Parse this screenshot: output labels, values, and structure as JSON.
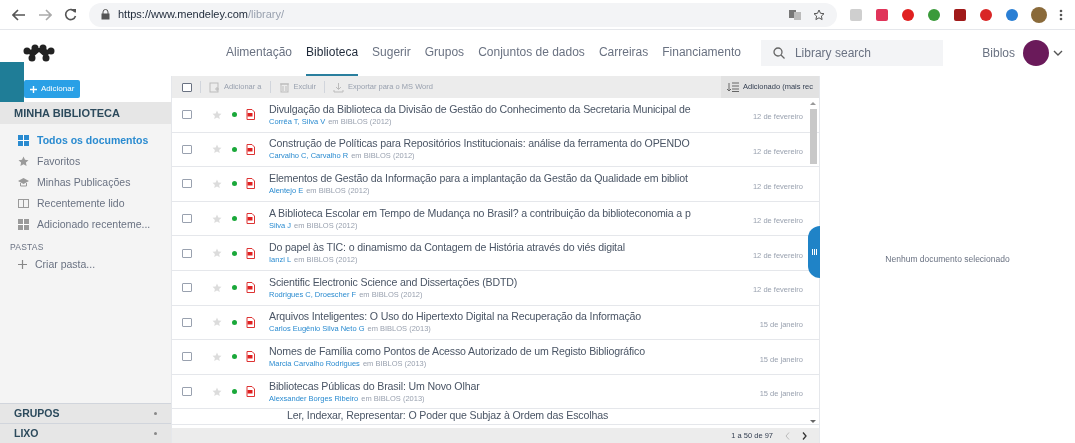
{
  "browser": {
    "url_host": "https://www.mendeley.com",
    "url_path": "/library/"
  },
  "nav": [
    {
      "label": "Alimentação",
      "selected": false
    },
    {
      "label": "Biblioteca",
      "selected": true
    },
    {
      "label": "Sugerir",
      "selected": false
    },
    {
      "label": "Grupos",
      "selected": false
    },
    {
      "label": "Conjuntos de dados",
      "selected": false
    },
    {
      "label": "Carreiras",
      "selected": false
    },
    {
      "label": "Financiamento",
      "selected": false
    }
  ],
  "search": {
    "placeholder": "Library search"
  },
  "user": {
    "name": "Biblos"
  },
  "sidebar": {
    "add_button": "Adicionar",
    "title": "MINHA BIBLIOTECA",
    "items": [
      {
        "label": "Todos os documentos",
        "kind": "grid",
        "selected": true
      },
      {
        "label": "Favoritos",
        "kind": "star",
        "selected": false
      },
      {
        "label": "Minhas Publicações",
        "kind": "cap",
        "selected": false
      },
      {
        "label": "Recentemente lido",
        "kind": "book",
        "selected": false
      },
      {
        "label": "Adicionado recenteme...",
        "kind": "grid",
        "selected": false
      }
    ],
    "folders_title": "PASTAS",
    "create_folder": "Criar pasta...",
    "bottom": [
      "GRUPOS",
      "LIXO"
    ]
  },
  "toolbar": {
    "select_all_checked": false,
    "add_to": "Adicionar a",
    "delete": "Excluir",
    "export": "Exportar para o MS Word",
    "sort": "Adicionado (mais rec"
  },
  "rows": [
    {
      "kind": "document",
      "title": "Divulgação da Biblioteca da Divisão de Gestão do Conhecimento da Secretaria Municipal de",
      "authors": "Corrêa T, Silva V",
      "source": "em BIBLOS (2012)",
      "date": "12 de fevereiro",
      "checked": false,
      "starred": false,
      "unread": true
    },
    {
      "kind": "document",
      "title": "Construção de Políticas para Repositórios Institucionais: análise da ferramenta do OPENDO",
      "authors": "Carvalho C, Carvalho R",
      "source": "em BIBLOS (2012)",
      "date": "12 de fevereiro",
      "checked": false,
      "starred": false,
      "unread": true
    },
    {
      "kind": "document",
      "title": "Elementos de Gestão da Informação para a implantação da Gestão da Qualidade em bibliot",
      "authors": "Alentejo E",
      "source": "em BIBLOS (2012)",
      "date": "12 de fevereiro",
      "checked": false,
      "starred": false,
      "unread": true
    },
    {
      "kind": "document",
      "title": "A Biblioteca Escolar em Tempo de Mudança no Brasil? a contribuição da biblioteconomia a p",
      "authors": "Silva J",
      "source": "em BIBLOS (2012)",
      "date": "12 de fevereiro",
      "checked": false,
      "starred": false,
      "unread": true
    },
    {
      "kind": "document",
      "title": "Do papel às TIC: o dinamismo da Contagem de História através do viés digital",
      "authors": "Ianzi L",
      "source": "em BIBLOS (2012)",
      "date": "12 de fevereiro",
      "checked": false,
      "starred": false,
      "unread": true
    },
    {
      "kind": "document",
      "title": "Scientific Electronic Science and Dissertações (BDTD)",
      "authors": "Rodrigues C, Droescher F",
      "source": "em BIBLOS (2012)",
      "date": "12 de fevereiro",
      "checked": false,
      "starred": false,
      "unread": true
    },
    {
      "kind": "document",
      "title": "Arquivos Inteligentes: O Uso do Hipertexto Digital na Recuperação da Informação",
      "authors": "Carlos Eugênio Silva Neto G",
      "source": "em BIBLOS (2013)",
      "date": "15 de janeiro",
      "checked": false,
      "starred": false,
      "unread": true
    },
    {
      "kind": "document",
      "title": "Nomes de Família como Pontos de Acesso Autorizado de um Registo Bibliográfico",
      "authors": "Marcia Carvalho Rodrigues",
      "source": "em BIBLOS (2013)",
      "date": "15 de janeiro",
      "checked": false,
      "starred": false,
      "unread": true
    },
    {
      "kind": "document",
      "title": "Bibliotecas Públicas do Brasil: Um Novo Olhar",
      "authors": "Alexsander Borges Ribeiro",
      "source": "em BIBLOS (2013)",
      "date": "15 de janeiro",
      "checked": false,
      "starred": false,
      "unread": true
    },
    {
      "kind": "partial",
      "title": "Ler, Indexar, Representar: O Poder que Subjaz à Ordem das Escolhas"
    }
  ],
  "pagination": "1 a 50 de 97",
  "detail": {
    "empty_text": "Nenhum documento selecionado"
  }
}
